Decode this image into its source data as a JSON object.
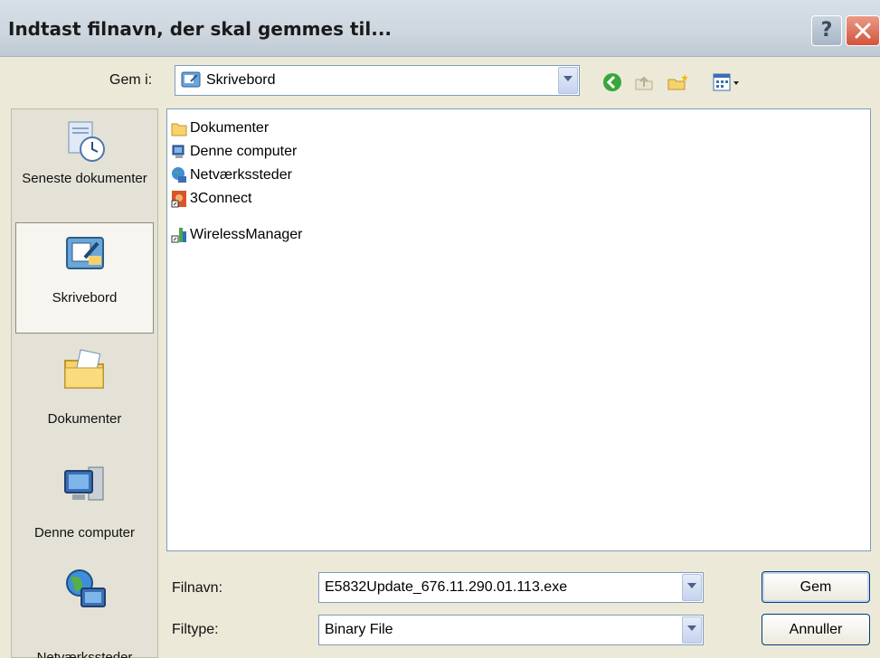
{
  "window": {
    "title": "Indtast filnavn, der skal gemmes til...",
    "help_label": "?",
    "close_label": "✕"
  },
  "toolbar": {
    "save_in_label": "Gem i:",
    "save_in_value": "Skrivebord",
    "icons": [
      "back-icon",
      "up-folder-icon",
      "new-folder-icon",
      "views-menu-icon"
    ]
  },
  "places": [
    {
      "label": "Seneste dokumenter",
      "icon": "recent-documents-icon"
    },
    {
      "label": "Skrivebord",
      "icon": "desktop-icon",
      "selected": true
    },
    {
      "label": "Dokumenter",
      "icon": "my-documents-icon"
    },
    {
      "label": "Denne computer",
      "icon": "my-computer-icon"
    },
    {
      "label": "Netværkssteder",
      "icon": "network-places-icon"
    }
  ],
  "files": [
    {
      "name": "Dokumenter",
      "icon": "folder-icon"
    },
    {
      "name": "Denne computer",
      "icon": "computer-icon"
    },
    {
      "name": "Netværkssteder",
      "icon": "network-icon"
    },
    {
      "name": "3Connect",
      "icon": "3connect-shortcut-icon"
    },
    {
      "name": "WirelessManager",
      "icon": "wirelessmanager-shortcut-icon"
    }
  ],
  "form": {
    "filename_label": "Filnavn:",
    "filename_value": "E5832Update_676.11.290.01.113.exe",
    "filetype_label": "Filtype:",
    "filetype_value": "Binary File"
  },
  "buttons": {
    "save_label": "Gem",
    "cancel_label": "Annuller"
  }
}
